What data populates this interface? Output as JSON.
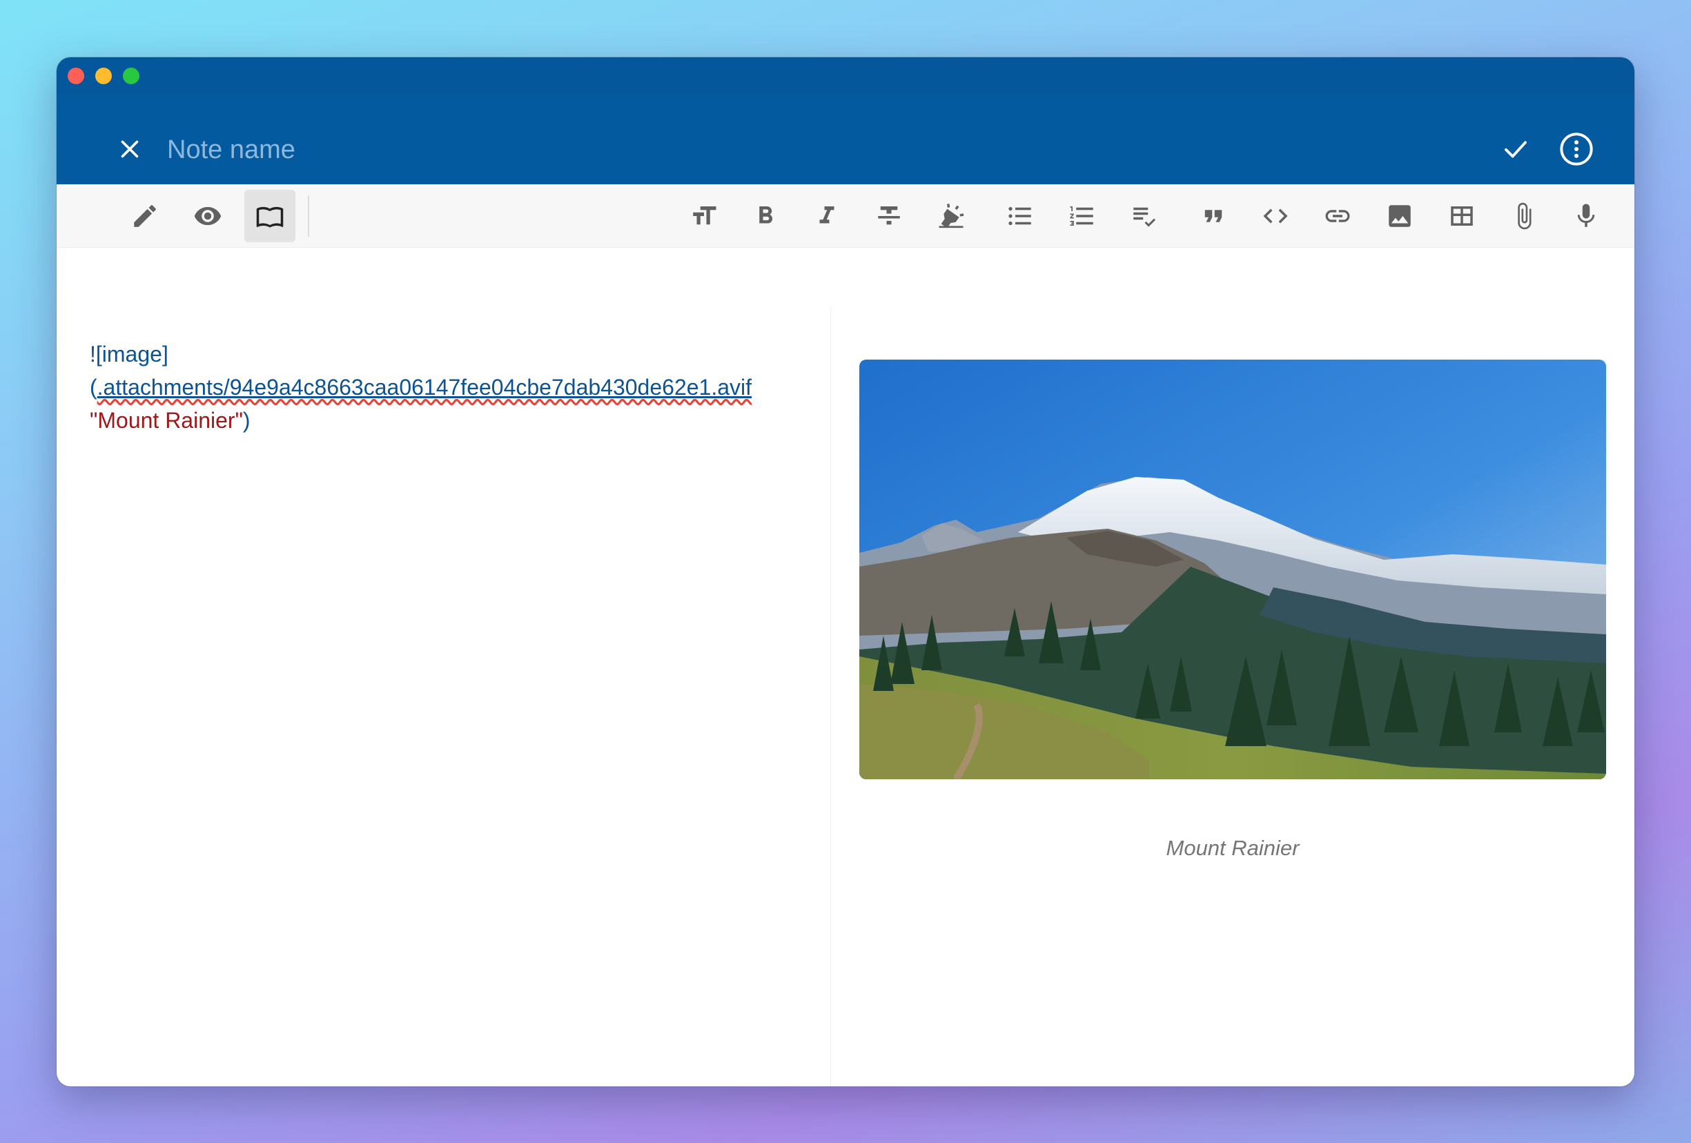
{
  "window": {
    "traffic_lights": [
      "close",
      "minimize",
      "zoom"
    ]
  },
  "appbar": {
    "note_name_placeholder": "Note name",
    "note_name_value": "",
    "colors": {
      "titlebar": "#04579a",
      "appbar": "#045a9e"
    }
  },
  "toolbar": {
    "mode_buttons": [
      {
        "icon": "pencil-icon",
        "label": "Edit"
      },
      {
        "icon": "eye-icon",
        "label": "Preview"
      },
      {
        "icon": "book-open-icon",
        "label": "Reader",
        "active": true
      }
    ],
    "format_buttons": [
      {
        "icon": "text-size-icon"
      },
      {
        "icon": "bold-icon"
      },
      {
        "icon": "italic-icon"
      },
      {
        "icon": "strikethrough-icon"
      },
      {
        "icon": "highlight-icon"
      },
      {
        "icon": "bulleted-list-icon"
      },
      {
        "icon": "numbered-list-icon"
      },
      {
        "icon": "checklist-icon"
      },
      {
        "icon": "quote-icon"
      },
      {
        "icon": "code-icon"
      },
      {
        "icon": "link-icon"
      },
      {
        "icon": "image-icon"
      },
      {
        "icon": "table-icon"
      },
      {
        "icon": "attachment-icon"
      },
      {
        "icon": "microphone-icon"
      },
      {
        "icon": "info-icon"
      }
    ]
  },
  "editor": {
    "alt_text": "![image]",
    "open_paren": "(",
    "url": ".attachments/94e9a4c8663caa06147fee04cbe7dab430de62e1.avif",
    "title": "\"Mount Rainier\"",
    "close_paren": ")"
  },
  "preview": {
    "image_subject": "mountain-landscape",
    "caption": "Mount Rainier"
  }
}
